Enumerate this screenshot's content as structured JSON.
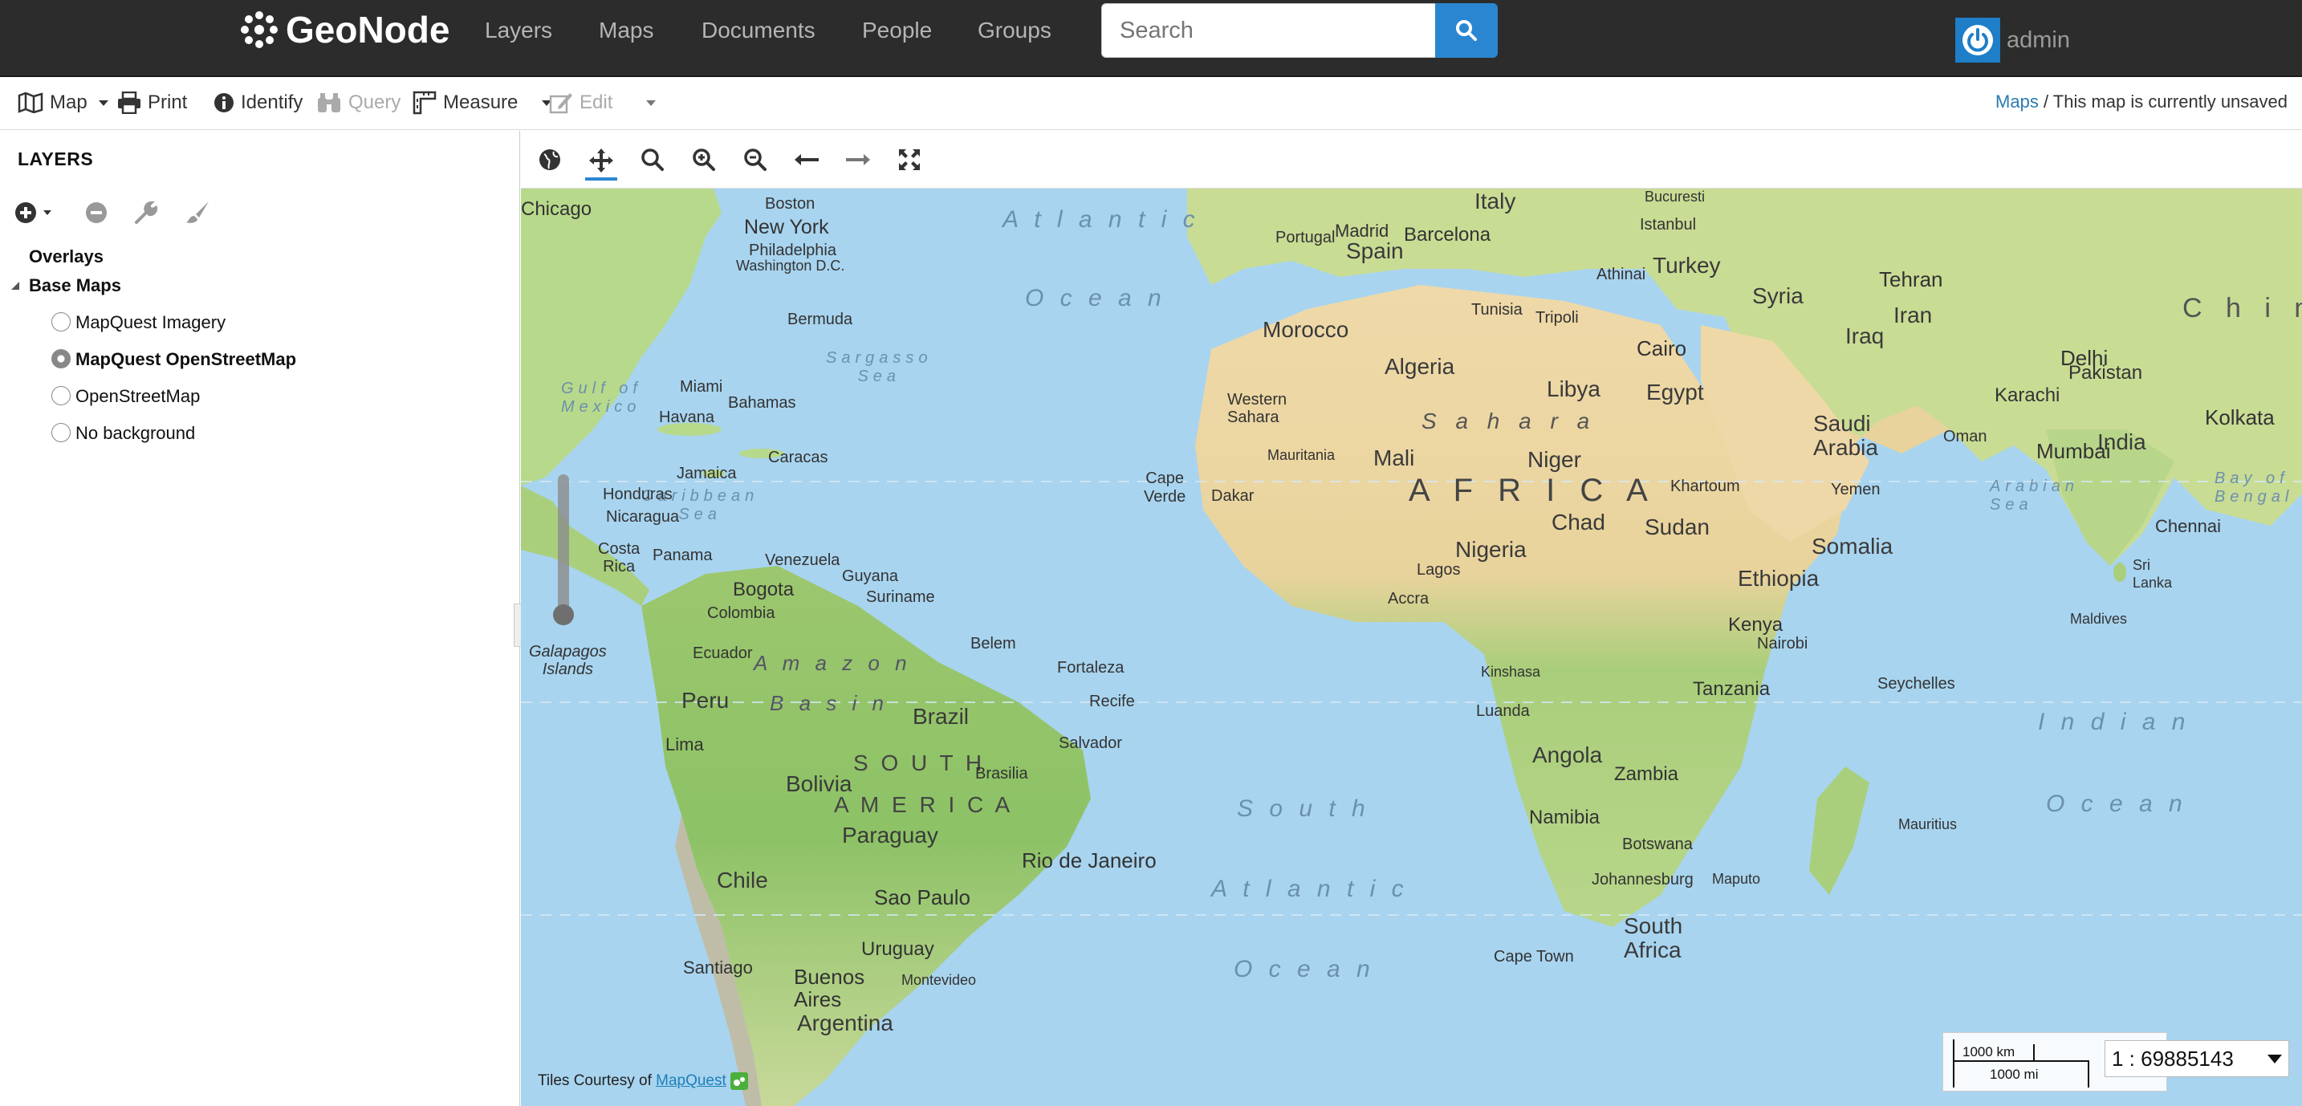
{
  "navbar": {
    "brand": "GeoNode",
    "links": [
      "Layers",
      "Maps",
      "Documents",
      "People",
      "Groups"
    ],
    "search_placeholder": "Search",
    "username": "admin"
  },
  "toolbar": {
    "map": "Map",
    "print": "Print",
    "identify": "Identify",
    "query": "Query",
    "measure": "Measure",
    "edit": "Edit"
  },
  "breadcrumb": {
    "link": "Maps",
    "text": " / This map is currently unsaved"
  },
  "layers": {
    "title": "LAYERS",
    "overlays": "Overlays",
    "base_maps": "Base Maps",
    "items": [
      {
        "label": "MapQuest Imagery",
        "selected": false
      },
      {
        "label": "MapQuest OpenStreetMap",
        "selected": true
      },
      {
        "label": "OpenStreetMap",
        "selected": false
      },
      {
        "label": "No background",
        "selected": false
      }
    ]
  },
  "map": {
    "attribution_prefix": "Tiles Courtesy of ",
    "attribution_link": "MapQuest",
    "scale_km": "1000 km",
    "scale_mi": "1000 mi",
    "scale_ratio": "1 : 69885143",
    "labels": {
      "africa": "A F R I C A",
      "sahara": "S a h a r a",
      "atlantic_n": "A t l a n t i c",
      "ocean_n": "O c e a n",
      "south": "S o u t h",
      "atlantic_s": "A t l a n t i c",
      "ocean_s": "O c e a n",
      "indian": "I n d i a n",
      "ocean_i": "O c e a n",
      "amazon": "A m a z o n",
      "basin": "B a s i n",
      "south_am": "S O U T H",
      "america": "A M E R I C A",
      "algeria": "Algeria",
      "libya": "Libya",
      "egypt": "Egypt",
      "mali": "Mali",
      "niger": "Niger",
      "chad": "Chad",
      "sudan": "Sudan",
      "nigeria": "Nigeria",
      "ethiopia": "Ethiopia",
      "somalia": "Somalia",
      "kenya": "Kenya",
      "tanzania": "Tanzania",
      "angola": "Angola",
      "zambia": "Zambia",
      "namibia": "Namibia",
      "botswana": "Botswana",
      "south_africa": "South\nAfrica",
      "brazil": "Brazil",
      "peru": "Peru",
      "bolivia": "Bolivia",
      "paraguay": "Paraguay",
      "chile": "Chile",
      "argentina": "Argentina",
      "uruguay": "Uruguay",
      "colombia": "Colombia",
      "venezuela": "Venezuela",
      "ecuador": "Ecuador",
      "morocco": "Morocco",
      "spain": "Spain",
      "portugal": "Portugal",
      "italy": "Italy",
      "turkey": "Turkey",
      "syria": "Syria",
      "iraq": "Iraq",
      "iran": "Iran",
      "saudi_arabia": "Saudi\nArabia",
      "yemen": "Yemen",
      "oman": "Oman",
      "india": "India",
      "pakistan": "Pakistan",
      "new_york": "New York",
      "boston": "Boston",
      "philadelphia": "Philadelphia",
      "washington": "Washington D.C.",
      "miami": "Miami",
      "havana": "Havana",
      "bahamas": "Bahamas",
      "jamaica": "Jamaica",
      "caracas": "Caracas",
      "bogota": "Bogota",
      "lima": "Lima",
      "sao_paulo": "Sao Paulo",
      "rio": "Rio de Janeiro",
      "buenos_aires": "Buenos\nAires",
      "santiago": "Santiago",
      "montevideo": "Montevideo",
      "recife": "Recife",
      "salvador": "Salvador",
      "fortaleza": "Fortaleza",
      "belem": "Belem",
      "brasilia": "Brasilia",
      "cairo": "Cairo",
      "dakar": "Dakar",
      "lagos": "Lagos",
      "accra": "Accra",
      "kinshasa": "Kinshasa",
      "nairobi": "Nairobi",
      "luanda": "Luanda",
      "cape_town": "Cape Town",
      "johannesburg": "Johannesburg",
      "maputo": "Maputo",
      "khartoum": "Khartoum",
      "tehran": "Tehran",
      "karachi": "Karachi",
      "mumbai": "Mumbai",
      "delhi": "Delhi",
      "kolkata": "Kolkata",
      "chennai": "Chennai",
      "madrid": "Madrid",
      "barcelona": "Barcelona",
      "bermuda": "Bermuda",
      "cape_verde": "Cape\nVerde",
      "seychelles": "Seychelles",
      "mauritius": "Mauritius",
      "maldives": "Maldives",
      "chicago": "Chicago",
      "honduras": "Honduras",
      "nicaragua": "Nicaragua",
      "costa_rica": "Costa\nRica",
      "panama": "Panama",
      "guyana": "Guyana",
      "suriname": "Suriname",
      "galapagos": "Galapagos\nIslands",
      "western_sahara": "Western\nSahara",
      "mauritania": "Mauritania",
      "tunisia": "Tunisia",
      "tripoli": "Tripoli",
      "athens": "Athinai",
      "istanbul": "Istanbul",
      "bucuresti": "Bucuresti",
      "china": "C h i n",
      "sri_lanka": "Sri\nLanka",
      "arabian_sea": "Arabian\nSea",
      "bay_of_bengal": "Bay of\nBengal",
      "caribbean": "Caribbean\nSea",
      "gulf_mexico": "Gulf of\nMexico",
      "sargasso": "Sargasso\nSea"
    }
  },
  "colors": {
    "navbar_bg": "#2c2c2c",
    "accent": "#2b86d1",
    "ocean": "#a8d4ef",
    "land_green": "#8fc46f",
    "land_desert": "#efd8a8",
    "link": "#2a7ab0"
  }
}
